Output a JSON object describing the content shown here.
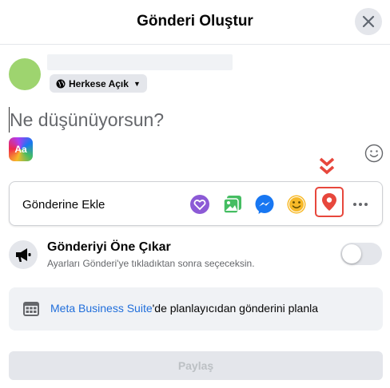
{
  "dialog": {
    "title": "Gönderi Oluştur"
  },
  "author": {
    "privacy_label": "Herkese Açık",
    "avatar_color": "#9ed46f"
  },
  "composer": {
    "placeholder": "Ne düşünüyorsun?",
    "text_format_label": "Aa"
  },
  "add_to_post": {
    "label": "Gönderine Ekle",
    "icons": [
      "heart-pinwheel-icon",
      "photo-video-icon",
      "messenger-icon",
      "feeling-icon",
      "location-icon",
      "more-icon"
    ],
    "highlight_color": "#e7473c"
  },
  "promote": {
    "title": "Gönderiyi Öne Çıkar",
    "subtitle": "Ayarları Gönderi'ye tıkladıktan sonra seçeceksin.",
    "toggle_on": false
  },
  "business_suite": {
    "link_text": "Meta Business Suite",
    "rest_text": "'de planlayıcıdan gönderini planla"
  },
  "share_button": {
    "label": "Paylaş"
  },
  "colors": {
    "link": "#216fdb",
    "location": "#e7473c",
    "photo": "#45bd62",
    "feeling": "#f7b928",
    "heart": "#8c5ad6",
    "messenger": "#1877f2"
  }
}
